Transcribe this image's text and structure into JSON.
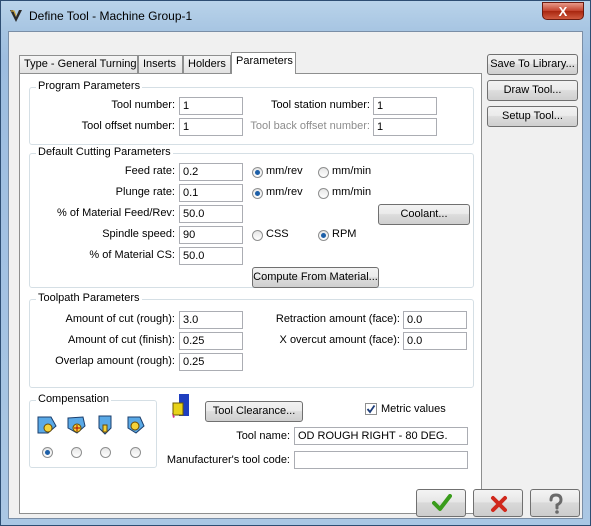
{
  "window": {
    "title": "Define Tool - Machine Group-1",
    "close_label": "X"
  },
  "tabs": [
    {
      "label": "Type - General Turning"
    },
    {
      "label": "Inserts"
    },
    {
      "label": "Holders"
    },
    {
      "label": "Parameters"
    }
  ],
  "side_buttons": {
    "save_to_library": "Save To Library...",
    "draw_tool": "Draw Tool...",
    "setup_tool": "Setup Tool..."
  },
  "program_parameters": {
    "title": "Program Parameters",
    "tool_number_label": "Tool number:",
    "tool_number": "1",
    "tool_station_label": "Tool station number:",
    "tool_station": "1",
    "tool_offset_label": "Tool offset number:",
    "tool_offset": "1",
    "tool_back_offset_label": "Tool back offset number:",
    "tool_back_offset": "1"
  },
  "cutting": {
    "title": "Default Cutting Parameters",
    "feed_rate_label": "Feed rate:",
    "feed_rate": "0.2",
    "plunge_rate_label": "Plunge rate:",
    "plunge_rate": "0.1",
    "material_feed_label": "% of Material Feed/Rev:",
    "material_feed": "50.0",
    "spindle_speed_label": "Spindle speed:",
    "spindle_speed": "90",
    "material_cs_label": "% of Material CS:",
    "material_cs": "50.0",
    "mm_rev": "mm/rev",
    "mm_min": "mm/min",
    "css": "CSS",
    "rpm": "RPM",
    "coolant": "Coolant...",
    "compute": "Compute From Material..."
  },
  "toolpath": {
    "title": "Toolpath Parameters",
    "cut_rough_label": "Amount of cut (rough):",
    "cut_rough": "3.0",
    "cut_finish_label": "Amount of cut (finish):",
    "cut_finish": "0.25",
    "overlap_label": "Overlap amount (rough):",
    "overlap": "0.25",
    "retraction_label": "Retraction amount (face):",
    "retraction": "0.0",
    "overcut_label": "X overcut amount (face):",
    "overcut": "0.0"
  },
  "compensation": {
    "title": "Compensation"
  },
  "tool_clearance": "Tool Clearance...",
  "metric_label": "Metric values",
  "metric_checked": true,
  "tool_name_label": "Tool name:",
  "tool_name": "OD ROUGH RIGHT - 80 DEG.",
  "manufacturer_label": "Manufacturer's tool code:",
  "manufacturer_code": "",
  "colors": {
    "accent": "#1d5fa8",
    "ok": "#3a9c1c",
    "cancel": "#d0281c"
  }
}
